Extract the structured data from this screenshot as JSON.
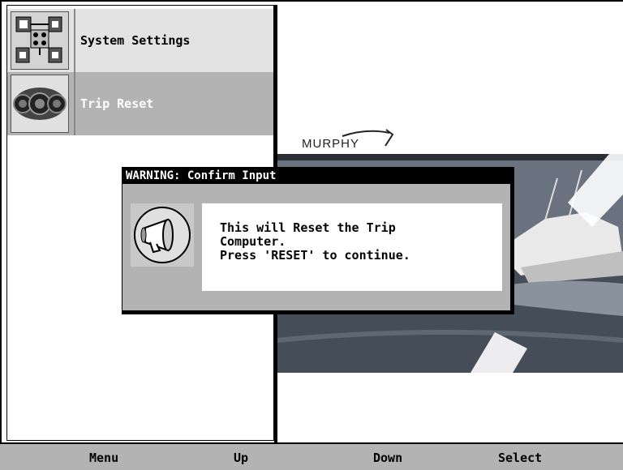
{
  "menu": {
    "items": [
      {
        "label": "System Settings",
        "icon": "system-settings-icon",
        "selected": false
      },
      {
        "label": "Trip Reset",
        "icon": "trip-reset-icon",
        "selected": true
      }
    ]
  },
  "splash": {
    "logo_text": "MURPHY"
  },
  "dialog": {
    "title": "WARNING: Confirm Input",
    "icon": "megaphone-icon",
    "message": "This will Reset the Trip\nComputer.\nPress 'RESET' to continue."
  },
  "softkeys": {
    "menu_label": "Menu",
    "up_label": "Up",
    "down_label": "Down",
    "select_label": "Select"
  },
  "colors": {
    "highlight": "#b3b3b3",
    "titlebar": "#000000",
    "panel": "#e3e3e3"
  }
}
